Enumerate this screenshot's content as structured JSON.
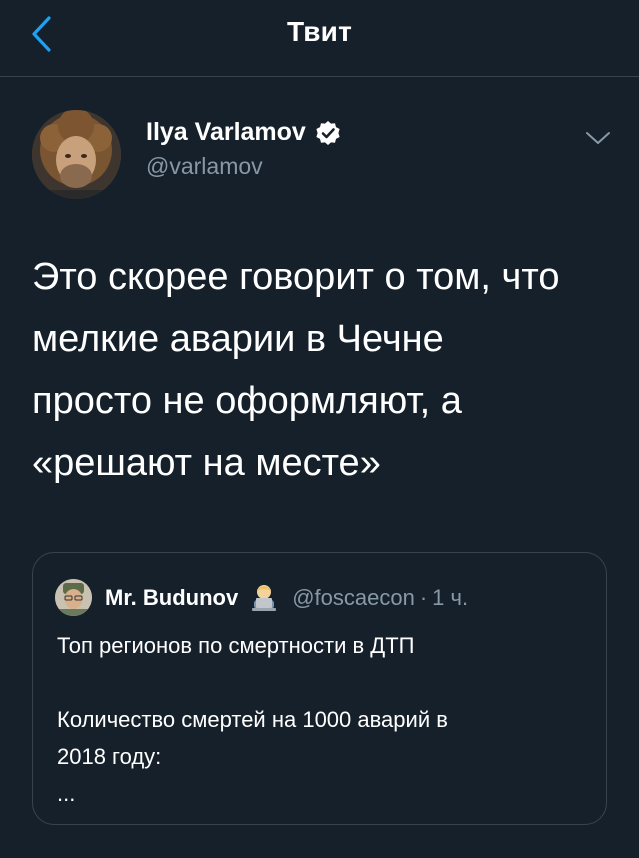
{
  "header": {
    "title": "Твит",
    "back_icon": "chevron-left-icon"
  },
  "colors": {
    "background": "#15202b",
    "accent": "#1da1f2",
    "secondary_text": "#8899a6",
    "divider": "#38444d"
  },
  "tweet": {
    "author": {
      "name": "Ilya Varlamov",
      "handle": "@varlamov",
      "verified": true
    },
    "text": "Это скорее говорит о том, что\nмелкие аварии в Чечне\nпросто не оформляют, а\n«решают на месте»",
    "menu_icon": "chevron-down-icon"
  },
  "quoted_tweet": {
    "author": {
      "name": "Mr. Budunov",
      "handle": "@foscaecon",
      "emoji_icon": "man-technologist-emoji"
    },
    "dot": "·",
    "time": "1 ч.",
    "lines": [
      "Топ регионов по смертности в ДТП",
      "",
      "Количество смертей на 1000 аварий в",
      "2018 году:",
      "..."
    ]
  }
}
